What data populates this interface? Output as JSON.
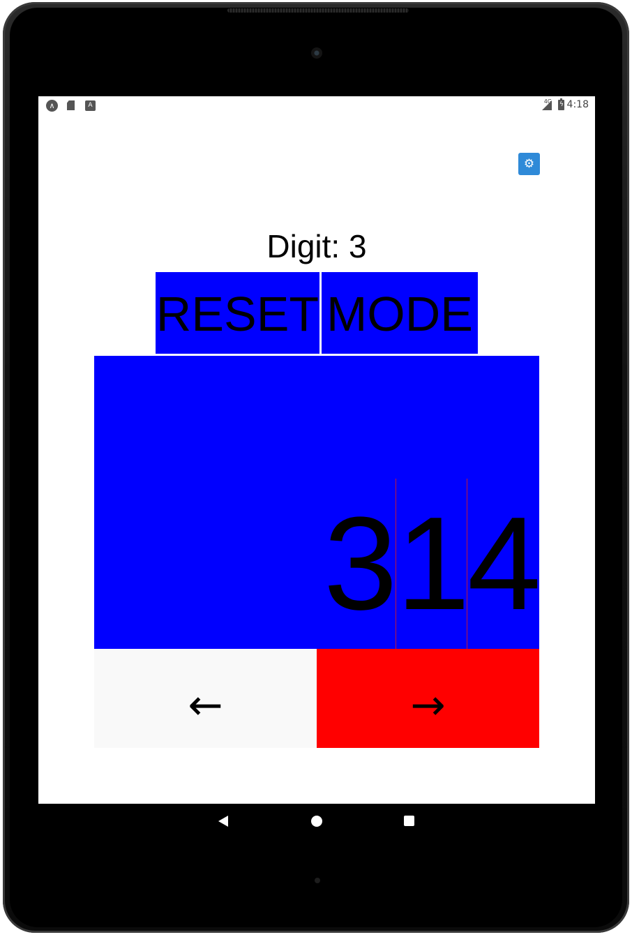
{
  "status_bar": {
    "time": "4:18",
    "network": "4G",
    "icons": [
      "launcher-icon",
      "sd-card-icon",
      "a-icon",
      "signal-icon",
      "battery-charging-icon"
    ]
  },
  "settings": {
    "icon": "gear-icon",
    "glyph": "⚙",
    "color": "#2f8ad8"
  },
  "digit": {
    "label": "Digit:  3"
  },
  "buttons": {
    "reset": "RESET",
    "mode": "MODE"
  },
  "display": {
    "digits": [
      "3",
      "1",
      "4"
    ],
    "background": "#0000ff"
  },
  "nav_arrows": {
    "left": "←",
    "right": "→",
    "left_color": "#f9f9f9",
    "right_color": "#ff0000"
  },
  "system_nav": {
    "back": "back-icon",
    "home": "home-icon",
    "recents": "recents-icon"
  }
}
